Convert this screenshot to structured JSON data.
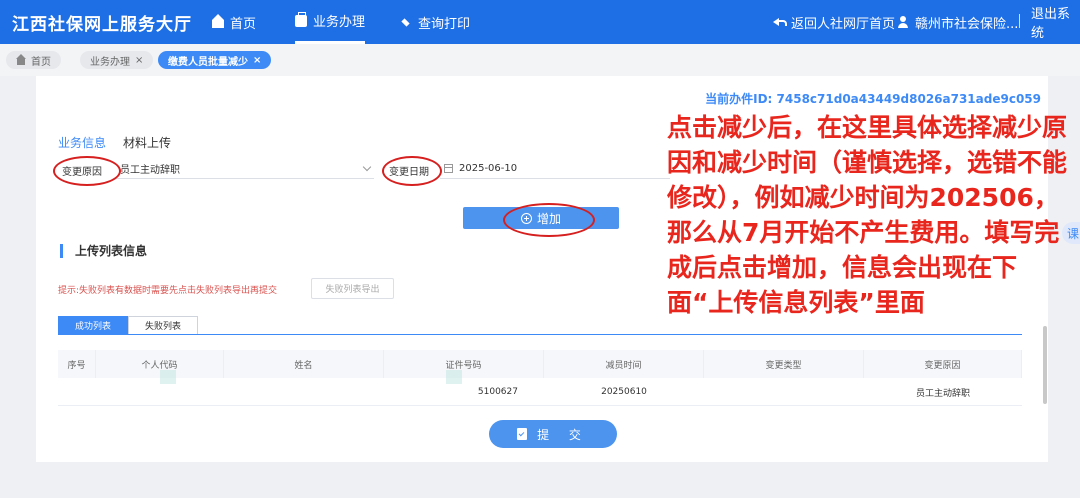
{
  "header": {
    "title": "江西社保网上服务大厅",
    "nav": [
      {
        "label": "首页",
        "icon": "home-icon"
      },
      {
        "label": "业务办理",
        "icon": "briefcase-icon",
        "active": true
      },
      {
        "label": "查询打印",
        "icon": "layers-icon"
      }
    ],
    "back_link": "返回人社网厅首页",
    "user": "赣州市社会保险...",
    "logout": "退出系统"
  },
  "tabs": [
    {
      "label": "首页"
    },
    {
      "label": "业务办理"
    },
    {
      "label": "缴费人员批量减少",
      "current": true
    }
  ],
  "job_id": "当前办件ID: 7458c71d0a43449d8026a731ade9c059",
  "section_tabs": {
    "business": "业务信息",
    "upload": "材料上传"
  },
  "form": {
    "reason_label": "变更原因",
    "reason_value": "员工主动辞职",
    "date_label": "变更日期",
    "date_value": "2025-06-10"
  },
  "add_button": "增加",
  "upload_section_title": "上传列表信息",
  "hint": "提示:失败列表有数据时需要先点击失败列表导出再提交",
  "export_button": "失败列表导出",
  "list_tabs": {
    "success": "成功列表",
    "fail": "失败列表"
  },
  "table": {
    "headers": [
      "序号",
      "个人代码",
      "姓名",
      "证件号码",
      "减员时间",
      "变更类型",
      "变更原因"
    ],
    "rows": [
      [
        "",
        "",
        "",
        "5100627",
        "20250610",
        "",
        "员工主动辞职"
      ]
    ]
  },
  "submit_button": "提 交",
  "annotation": "点击减少后，在这里具体选择减少原因和减少时间（谨慎选择，选错不能修改），例如减少时间为202506，那么从7月开始不产生费用。填写完成后点击增加，信息会出现在下面“上传信息列表”里面",
  "side_float": "课",
  "colors": {
    "primary": "#1e6fe6",
    "accent": "#3d8af7",
    "annotation": "#e8261e",
    "ring": "#d61f1f"
  }
}
